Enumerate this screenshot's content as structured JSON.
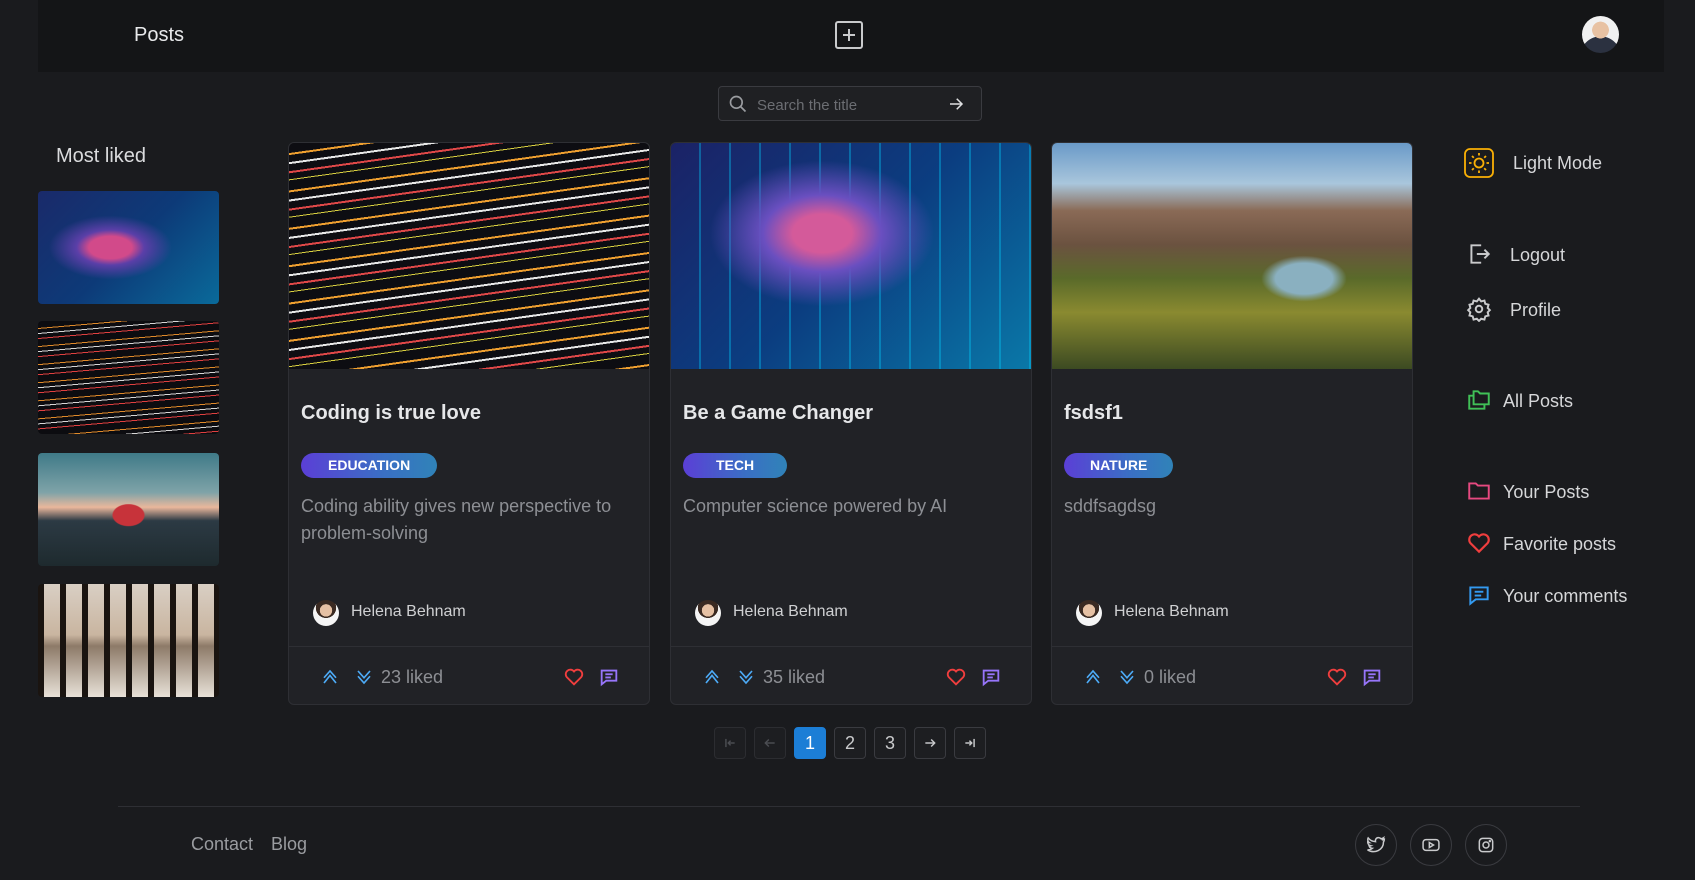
{
  "header": {
    "title": "Posts"
  },
  "search": {
    "placeholder": "Search the title"
  },
  "most_liked": {
    "title": "Most liked"
  },
  "posts": [
    {
      "title": "Coding is true love",
      "category": "EDUCATION",
      "description": "Coding ability gives new perspective to problem-solving",
      "author": "Helena Behnam",
      "liked": "23 liked"
    },
    {
      "title": "Be a Game Changer",
      "category": "TECH",
      "description": "Computer science powered by AI",
      "author": "Helena Behnam",
      "liked": "35 liked"
    },
    {
      "title": "fsdsf1",
      "category": "NATURE",
      "description": "sddfsagdsg",
      "author": "Helena Behnam",
      "liked": "0 liked"
    }
  ],
  "pagination": {
    "pages": [
      "1",
      "2",
      "3"
    ],
    "current": "1"
  },
  "nav": {
    "light_mode": "Light Mode",
    "logout": "Logout",
    "profile": "Profile",
    "all_posts": "All Posts",
    "your_posts": "Your Posts",
    "favorite_posts": "Favorite posts",
    "your_comments": "Your comments"
  },
  "footer": {
    "contact": "Contact",
    "blog": "Blog"
  },
  "colors": {
    "accent": "#1c7ed6",
    "heart": "#f03e3e",
    "green": "#40c057",
    "pink": "#e64980",
    "yellow": "#fab005"
  },
  "icons": [
    "plus-square-icon",
    "search-icon",
    "arrow-right-icon",
    "sun-icon",
    "logout-icon",
    "gear-icon",
    "folders-icon",
    "folder-icon",
    "heart-icon",
    "message-icon",
    "twitter-icon",
    "youtube-icon",
    "instagram-icon"
  ]
}
